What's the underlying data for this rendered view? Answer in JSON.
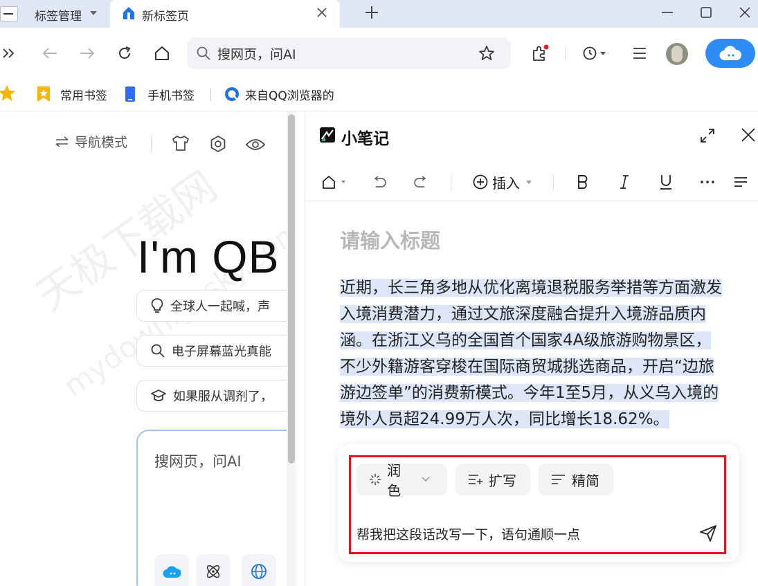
{
  "tabs": [
    {
      "label": "标签管理",
      "active": false
    },
    {
      "label": "新标签页",
      "active": true
    }
  ],
  "toolbar": {
    "address_placeholder": "搜网页，问AI"
  },
  "bookmarks": [
    {
      "label": "常用书签",
      "icon": "bookmark-icon"
    },
    {
      "label": "手机书签",
      "icon": "phone-icon"
    },
    {
      "label": "来自QQ浏览器的",
      "icon": "qq-browser-icon"
    }
  ],
  "newtab": {
    "nav_mode": "导航模式",
    "logo": "I'm QB",
    "chips": [
      {
        "text": "全球人一起喊，声",
        "icon": "lightbulb-icon"
      },
      {
        "text": "电子屏幕蓝光真能",
        "icon": "search-icon"
      },
      {
        "text": "如果服从调剂了，",
        "icon": "graduation-cap-icon"
      }
    ],
    "search_placeholder": "搜网页，问AI"
  },
  "notes": {
    "title": "小笔记",
    "insert_label": "插入",
    "heading_placeholder": "请输入标题",
    "body_lines": [
      "近期，长三角多地从优化离境退税服务举措等方面激发",
      "入境消费潜力，通过文旅深度融合提升入境游品质内",
      "涵。在浙江义乌的全国首个国家4A级旅游购物景区，",
      "不少外籍游客穿梭在国际商贸城挑选商品，开启“边旅",
      "游边签单”的消费新模式。今年1至5月，从义乌入境的",
      "境外人员超24.99万人次，同比增长18.62%。"
    ],
    "ai": {
      "polish": "润色",
      "expand": "扩写",
      "simplify": "精简",
      "prompt": "帮我把这段话改写一下，语句通顺一点"
    }
  },
  "colors": {
    "accent": "#2e8cf7",
    "highlight_box": "#e3151e",
    "selection": "#dde6f7"
  }
}
